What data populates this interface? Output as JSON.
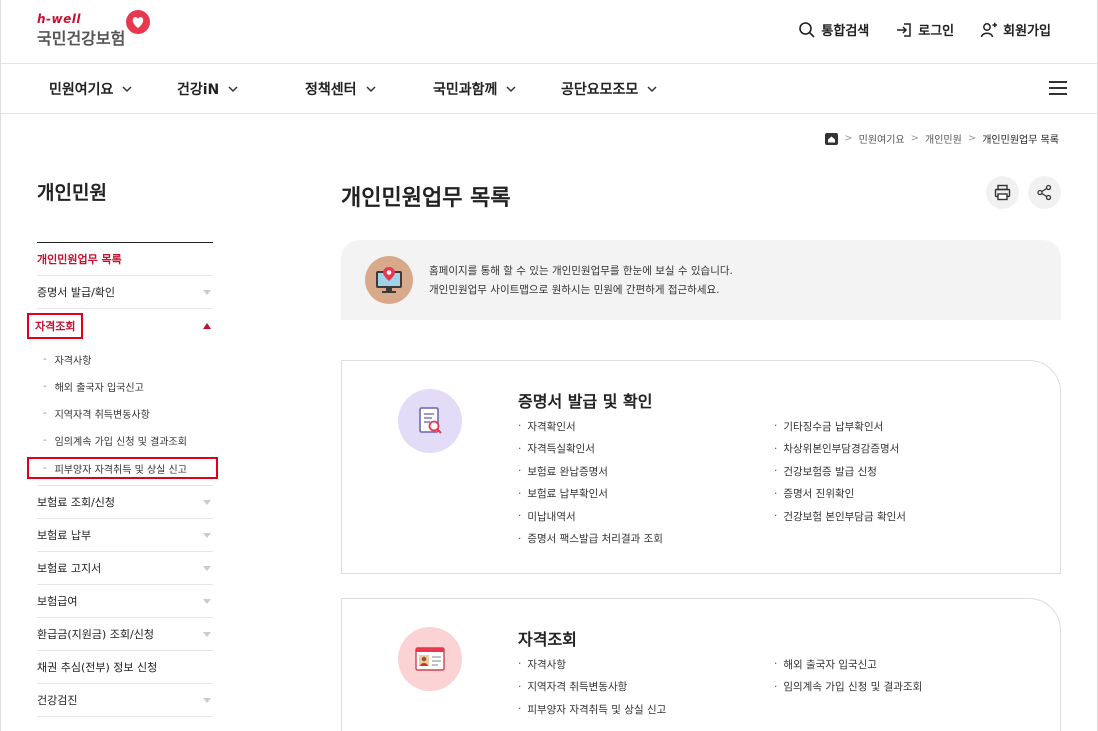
{
  "header": {
    "logo_top": "h-well",
    "logo_name": "국민건강보험",
    "util": [
      {
        "label": "통합검색",
        "icon": "search-icon"
      },
      {
        "label": "로그인",
        "icon": "login-icon"
      },
      {
        "label": "회원가입",
        "icon": "user-plus-icon"
      }
    ],
    "gnb": [
      "민원여기요",
      "건강iN",
      "정책센터",
      "국민과함께",
      "공단요모조모"
    ]
  },
  "breadcrumb": {
    "items": [
      "민원여기요",
      "개인민원",
      "개인민원업무 목록"
    ]
  },
  "sidebar": {
    "title": "개인민원",
    "items": [
      {
        "label": "개인민원업무 목록"
      },
      {
        "label": "증명서 발급/확인"
      },
      {
        "label": "자격조회"
      },
      {
        "label": "보험료 조회/신청"
      },
      {
        "label": "보험료 납부"
      },
      {
        "label": "보험료 고지서"
      },
      {
        "label": "보험급여"
      },
      {
        "label": "환급금(지원금) 조회/신청"
      },
      {
        "label": "채권 추심(전부) 정보 신청"
      },
      {
        "label": "건강검진"
      }
    ],
    "sub_items": [
      "자격사항",
      "해외 출국자 입국신고",
      "지역자격 취득변동사항",
      "임의계속 가입 신청 및 결과조회",
      "피부양자 자격취득 및 상실 신고"
    ]
  },
  "main": {
    "title": "개인민원업무 목록",
    "notice": [
      "홈페이지를 통해 할 수 있는 개인민원업무를 한눈에 보실 수 있습니다.",
      "개인민원업무 사이트맵으로 원하시는 민원에 간편하게 접근하세요."
    ],
    "cards": [
      {
        "title": "증명서 발급 및 확인",
        "left": [
          "자격확인서",
          "자격득실확인서",
          "보험료 완납증명서",
          "보험료 납부확인서",
          "미납내역서",
          "증명서 팩스발급 처리결과 조회"
        ],
        "right": [
          "기타징수금 납부확인서",
          "차상위본인부담경감증명서",
          "건강보험증 발급 신청",
          "증명서 진위확인",
          "건강보험 본인부담금 확인서"
        ]
      },
      {
        "title": "자격조회",
        "left": [
          "자격사항",
          "지역자격 취득변동사항",
          "피부양자 자격취득 및 상실 신고"
        ],
        "right": [
          "해외 출국자 입국신고",
          "임의계속 가입 신청 및 결과조회"
        ]
      }
    ]
  },
  "colors": {
    "brand_red": "#c8102e",
    "highlight_red": "#e0001b"
  }
}
